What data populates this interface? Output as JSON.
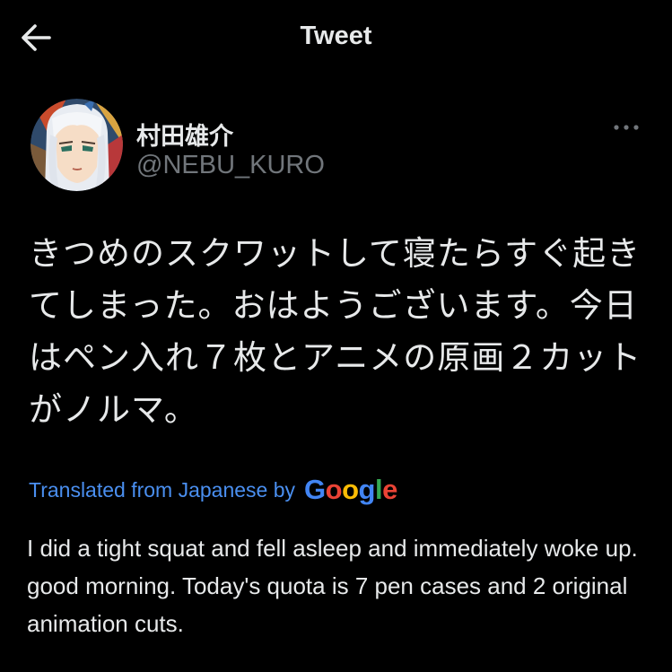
{
  "header": {
    "title": "Tweet",
    "back_icon": "arrow-left-icon"
  },
  "author": {
    "display_name": "村田雄介",
    "handle": "@NEBU_KURO",
    "avatar": "avatar-illustration",
    "more_icon": "more-horizontal-icon"
  },
  "tweet": {
    "text": "きつめのスクワットして寝たらすぐ起きてしまった。おはようございます。今日はペン入れ７枚とアニメの原画２カットがノルマ。"
  },
  "translation": {
    "label": "Translated from Japanese by",
    "provider": "Google",
    "text": "I did a tight squat and fell asleep and immediately woke up. good morning. Today's quota is 7 pen cases and 2 original animation cuts."
  },
  "colors": {
    "background": "#000000",
    "text_primary": "#e7e9ea",
    "text_secondary": "#71767b",
    "link": "#4a8ff0",
    "google_blue": "#4285F4",
    "google_red": "#EA4335",
    "google_yellow": "#FBBC05",
    "google_green": "#34A853"
  }
}
